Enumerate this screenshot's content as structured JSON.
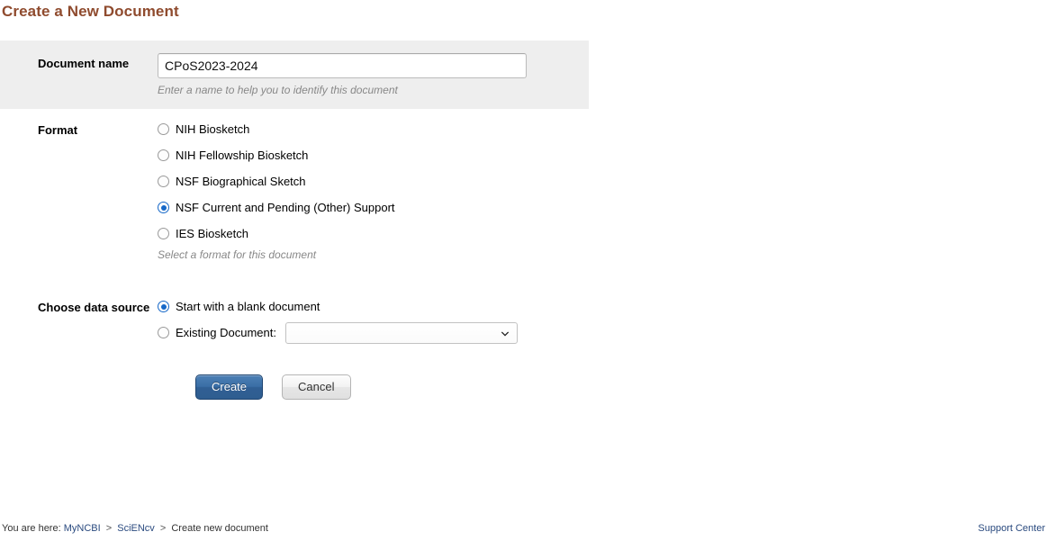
{
  "page": {
    "title": "Create a New Document",
    "title_color": "#8f4b2e"
  },
  "document_name": {
    "label": "Document name",
    "value": "CPoS2023-2024",
    "placeholder": "",
    "hint": "Enter a name to help you to identify this document"
  },
  "format": {
    "label": "Format",
    "hint": "Select a format for this document",
    "options": [
      {
        "label": "NIH Biosketch",
        "selected": false
      },
      {
        "label": "NIH Fellowship Biosketch",
        "selected": false
      },
      {
        "label": "NSF Biographical Sketch",
        "selected": false
      },
      {
        "label": "NSF Current and Pending (Other) Support",
        "selected": true
      },
      {
        "label": "IES Biosketch",
        "selected": false
      }
    ]
  },
  "data_source": {
    "label": "Choose data source",
    "options": [
      {
        "label": "Start with a blank document",
        "selected": true
      },
      {
        "label": "Existing Document:",
        "selected": false
      }
    ],
    "existing_document_select": {
      "value": "",
      "icon": "chevron-down-icon",
      "options": []
    }
  },
  "buttons": {
    "create": "Create",
    "cancel": "Cancel",
    "create_color": "#3a6ea5"
  },
  "footer": {
    "prefix": "You are here:",
    "crumb1": "MyNCBI",
    "sep1": ">",
    "crumb2": "SciENcv",
    "sep2": ">",
    "crumb3": "Create new document",
    "support": "Support Center",
    "link_color": "#2a4a7f"
  }
}
